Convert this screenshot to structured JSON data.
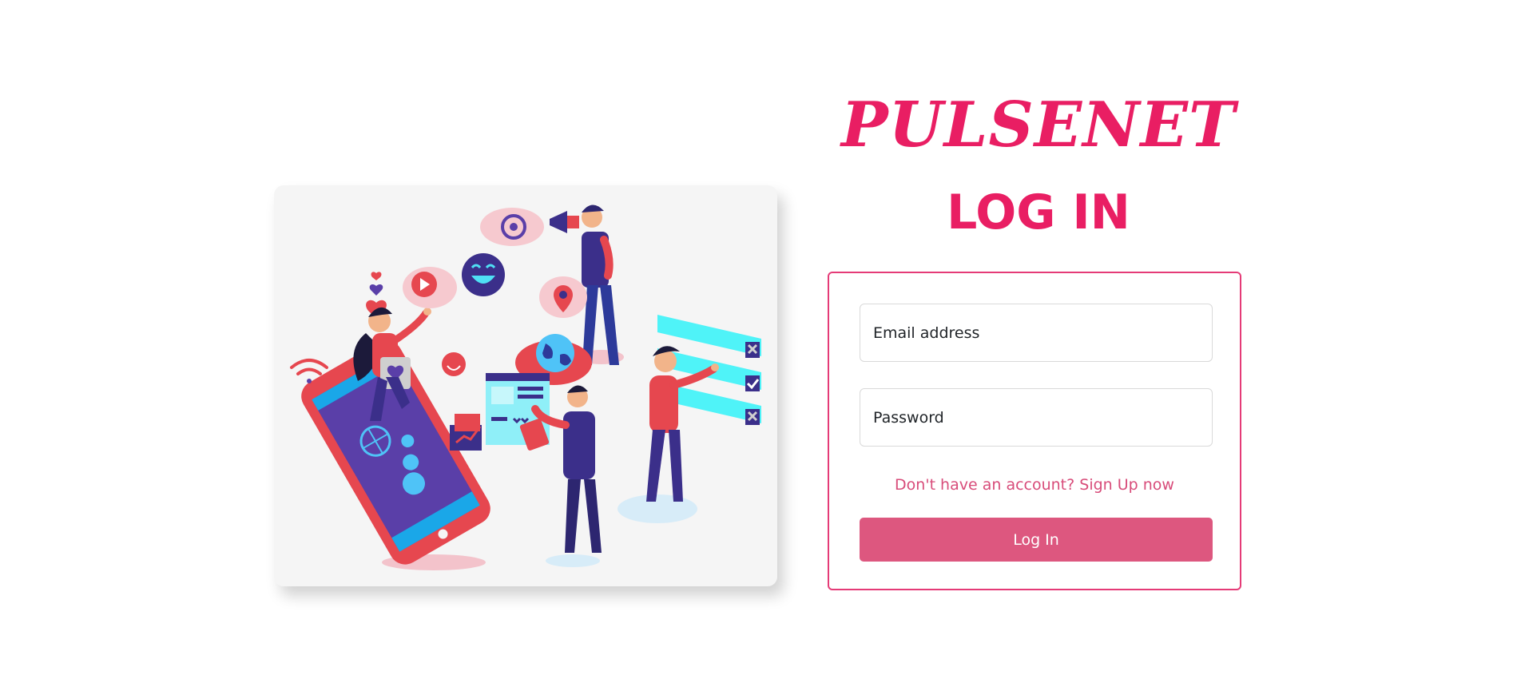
{
  "brand": {
    "name": "PULSENET"
  },
  "page": {
    "heading": "LOG IN"
  },
  "login_form": {
    "email_placeholder": "Email address",
    "password_placeholder": "Password",
    "signup_link_text": "Don't have an account? Sign Up now",
    "submit_label": "Log In"
  },
  "colors": {
    "accent": "#e91e63",
    "button": "#dd577f",
    "link": "#d84c7a",
    "form_border": "#e53b77",
    "illustration_bg": "#f5f5f5"
  },
  "illustration": {
    "icons": [
      "smartphone",
      "wifi-icon",
      "heart-icon",
      "play-icon",
      "smiley-icon",
      "at-sign-icon",
      "megaphone-icon",
      "location-pin-icon",
      "globe-icon",
      "chart-icon",
      "checkbox-list"
    ]
  }
}
